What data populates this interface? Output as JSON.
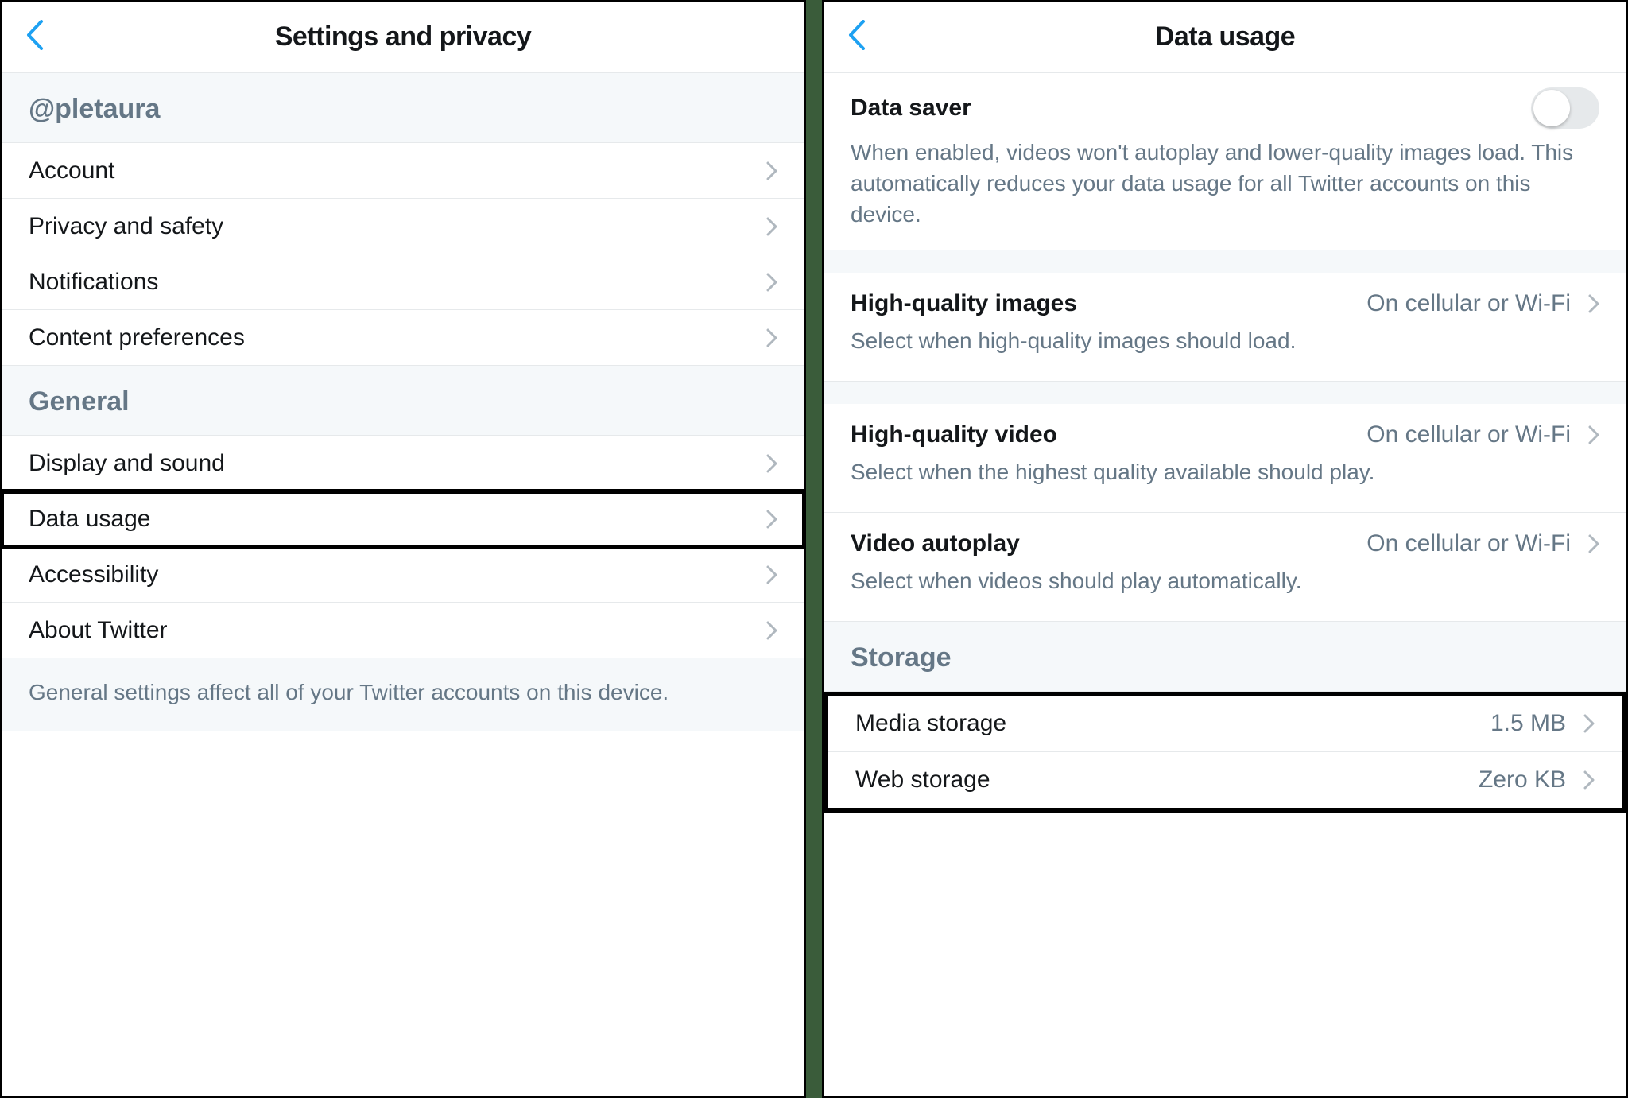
{
  "left": {
    "title": "Settings and privacy",
    "username_header": "@pletaura",
    "section1": {
      "items": [
        {
          "label": "Account"
        },
        {
          "label": "Privacy and safety"
        },
        {
          "label": "Notifications"
        },
        {
          "label": "Content preferences"
        }
      ]
    },
    "section2": {
      "header": "General",
      "items": [
        {
          "label": "Display and sound"
        },
        {
          "label": "Data usage",
          "highlight": true
        },
        {
          "label": "Accessibility"
        },
        {
          "label": "About Twitter"
        }
      ],
      "footer": "General settings affect all of your Twitter accounts on this device."
    }
  },
  "right": {
    "title": "Data usage",
    "data_saver": {
      "title": "Data saver",
      "desc": "When enabled, videos won't autoplay and lower-quality images load. This automatically reduces your data usage for all Twitter accounts on this device.",
      "on": false
    },
    "hq_images": {
      "title": "High-quality images",
      "value": "On cellular or Wi-Fi",
      "desc": "Select when high-quality images should load."
    },
    "hq_video": {
      "title": "High-quality video",
      "value": "On cellular or Wi-Fi",
      "desc": "Select when the highest quality available should play."
    },
    "video_autoplay": {
      "title": "Video autoplay",
      "value": "On cellular or Wi-Fi",
      "desc": "Select when videos should play automatically."
    },
    "storage": {
      "header": "Storage",
      "media": {
        "label": "Media storage",
        "value": "1.5 MB"
      },
      "web": {
        "label": "Web storage",
        "value": "Zero KB"
      }
    }
  }
}
